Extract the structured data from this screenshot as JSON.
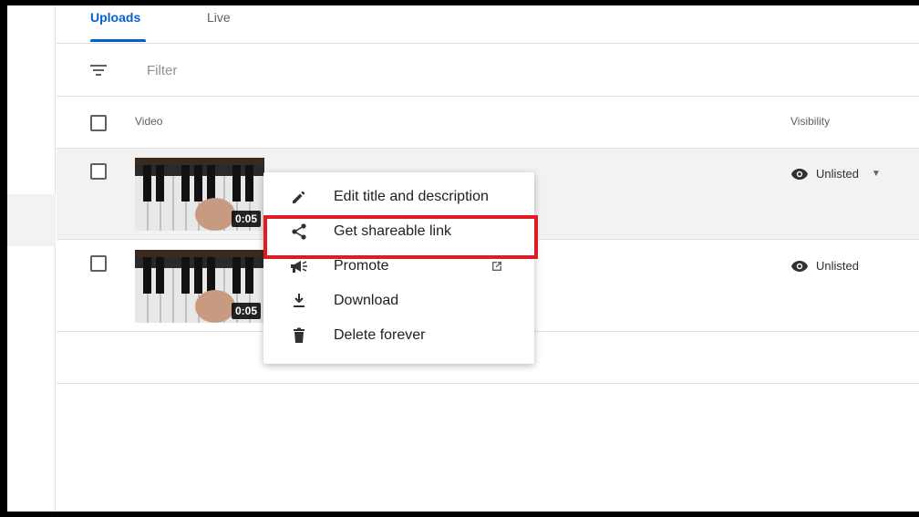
{
  "tabs": [
    {
      "label": "Uploads",
      "active": true
    },
    {
      "label": "Live",
      "active": false
    }
  ],
  "filter": {
    "placeholder": "Filter"
  },
  "table": {
    "columns": {
      "video": "Video",
      "visibility": "Visibility"
    },
    "rows": [
      {
        "duration": "0:05",
        "visibility": "Unlisted",
        "has_dropdown": true
      },
      {
        "duration": "0:05",
        "visibility": "Unlisted",
        "has_dropdown": false
      }
    ]
  },
  "context_menu": {
    "items": [
      {
        "label": "Edit title and description",
        "icon": "pencil-icon"
      },
      {
        "label": "Get shareable link",
        "icon": "share-icon",
        "highlighted": true
      },
      {
        "label": "Promote",
        "icon": "megaphone-icon",
        "external": true
      },
      {
        "label": "Download",
        "icon": "download-icon"
      },
      {
        "label": "Delete forever",
        "icon": "trash-icon"
      }
    ]
  },
  "colors": {
    "accent": "#065fd4",
    "highlight_border": "#e01b24"
  }
}
